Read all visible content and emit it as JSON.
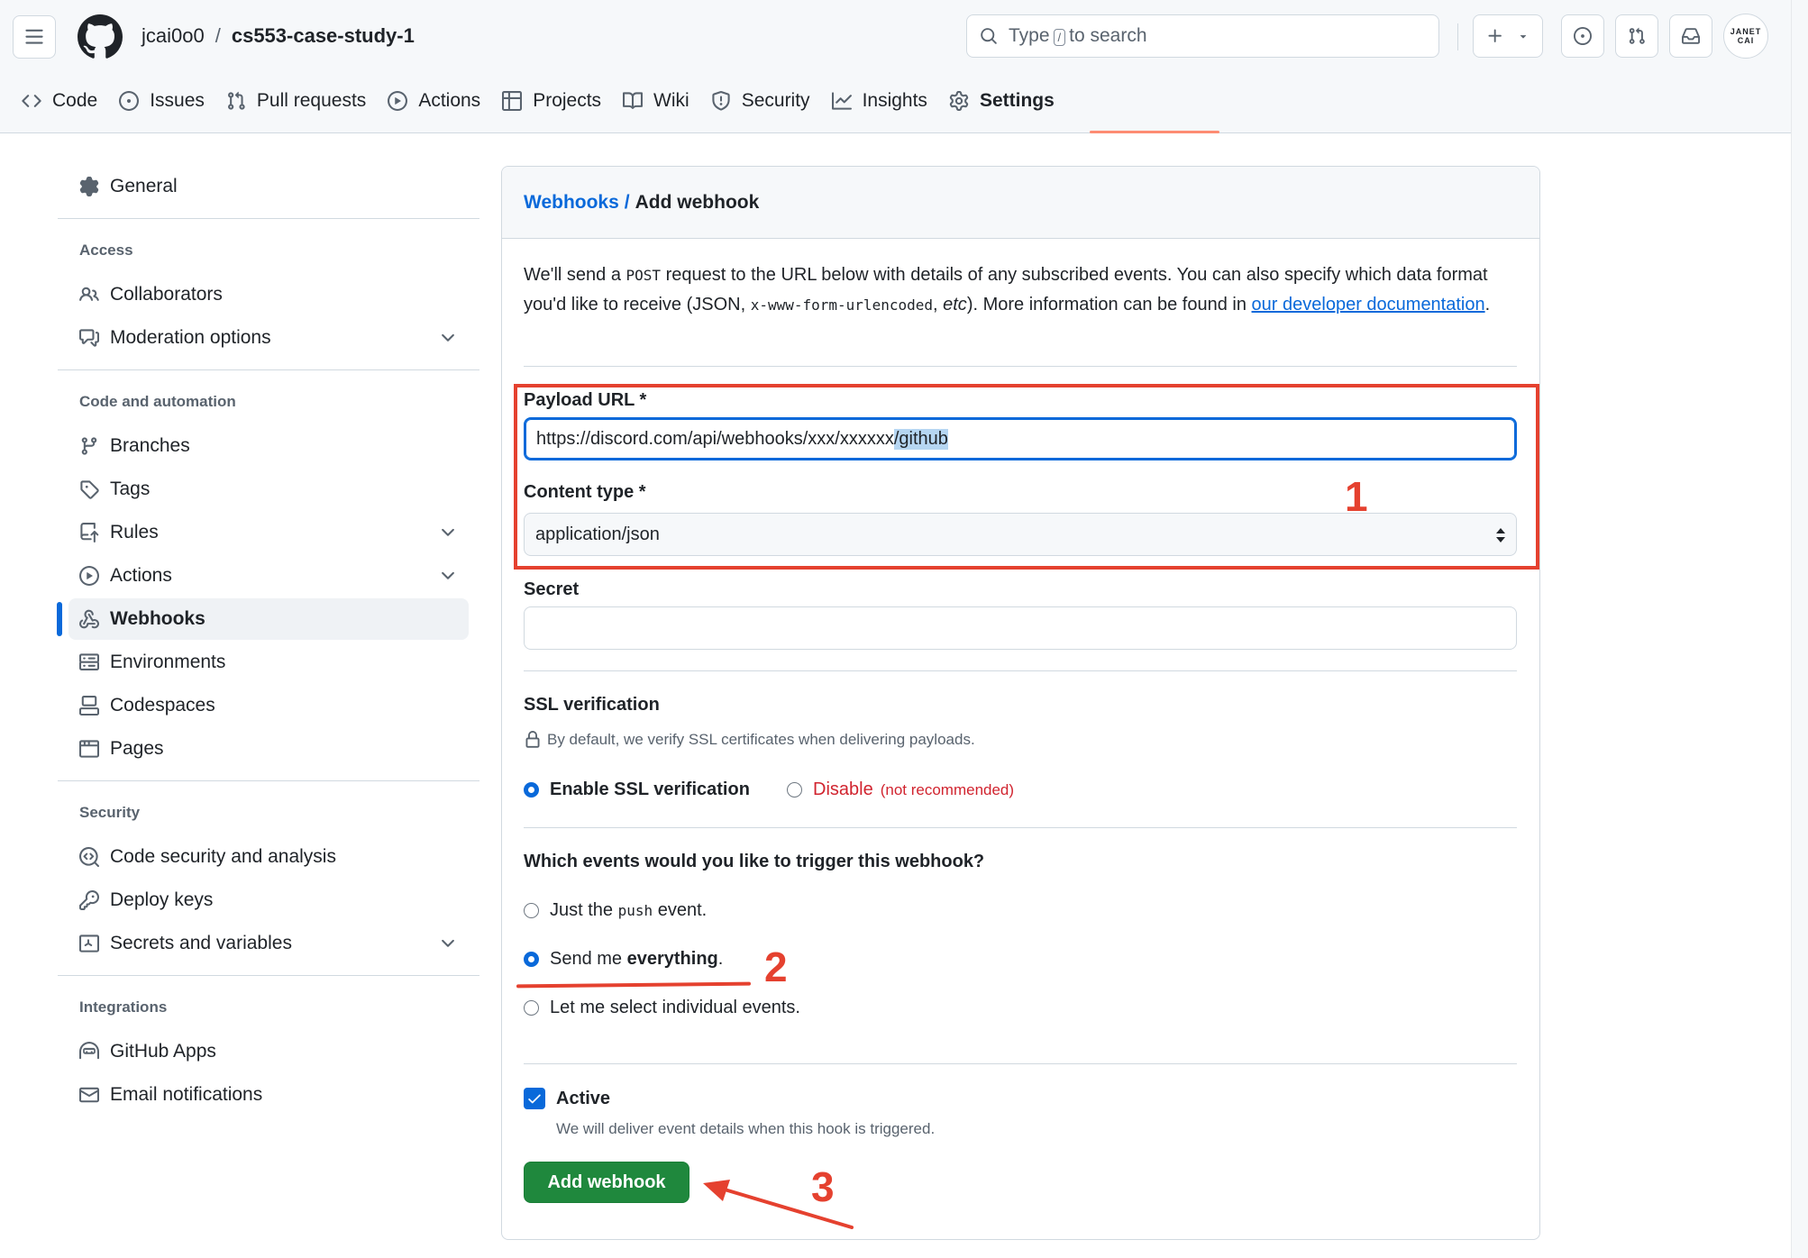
{
  "header": {
    "owner": "jcai0o0",
    "separator": "/",
    "repo": "cs553-case-study-1",
    "search": {
      "before": "Type",
      "key": "/",
      "after": "to search"
    },
    "avatar": {
      "line1": "JANET",
      "line2": "CAI"
    }
  },
  "tabs": [
    {
      "label": "Code",
      "icon": "code-icon"
    },
    {
      "label": "Issues",
      "icon": "issue-icon"
    },
    {
      "label": "Pull requests",
      "icon": "pull-request-icon"
    },
    {
      "label": "Actions",
      "icon": "play-icon"
    },
    {
      "label": "Projects",
      "icon": "table-icon"
    },
    {
      "label": "Wiki",
      "icon": "book-icon"
    },
    {
      "label": "Security",
      "icon": "shield-icon"
    },
    {
      "label": "Insights",
      "icon": "graph-icon"
    },
    {
      "label": "Settings",
      "icon": "gear-icon",
      "active": true
    }
  ],
  "sidebar": {
    "general": "General",
    "access_heading": "Access",
    "collaborators": "Collaborators",
    "moderation": "Moderation options",
    "code_heading": "Code and automation",
    "branches": "Branches",
    "tags": "Tags",
    "rules": "Rules",
    "actions": "Actions",
    "webhooks": "Webhooks",
    "environments": "Environments",
    "codespaces": "Codespaces",
    "pages": "Pages",
    "security_heading": "Security",
    "code_security": "Code security and analysis",
    "deploy_keys": "Deploy keys",
    "secrets": "Secrets and variables",
    "integrations_heading": "Integrations",
    "github_apps": "GitHub Apps",
    "email_notifications": "Email notifications"
  },
  "main": {
    "breadcrumb_link": "Webhooks",
    "breadcrumb_sep": "/",
    "breadcrumb_current": "Add webhook",
    "intro": {
      "part1": "We'll send a ",
      "code1": "POST",
      "part2": " request to the URL below with details of any subscribed events. You can also specify which data format you'd like to receive (JSON, ",
      "code2": "x-www-form-urlencoded",
      "part3": ", ",
      "etc": "etc",
      "part4": "). More information can be found in ",
      "link": "our developer documentation",
      "part5": "."
    },
    "payload_label": "Payload URL *",
    "payload_value_plain": "https://discord.com/api/webhooks/xxx/xxxxxx",
    "payload_value_selected": "/github",
    "content_type_label": "Content type *",
    "content_type_value": "application/json",
    "secret_label": "Secret",
    "secret_value": "",
    "ssl_heading": "SSL verification",
    "ssl_note": "By default, we verify SSL certificates when delivering payloads.",
    "ssl_enable": "Enable SSL verification",
    "ssl_disable": "Disable",
    "ssl_not_recommended": "(not recommended)",
    "events_heading": "Which events would you like to trigger this webhook?",
    "event_push_before": "Just the",
    "event_push_code": "push",
    "event_push_after": "event.",
    "event_everything_before": "Send me",
    "event_everything_bold": "everything",
    "event_everything_after": ".",
    "event_individual": "Let me select individual events.",
    "active_label": "Active",
    "active_note": "We will deliver event details when this hook is triggered.",
    "submit": "Add webhook"
  },
  "annotations": {
    "one": "1",
    "two": "2",
    "three": "3"
  },
  "colors": {
    "accent": "#0969da",
    "primary_button": "#1f883d",
    "annotation": "#e5412f",
    "danger": "#d1242f"
  }
}
